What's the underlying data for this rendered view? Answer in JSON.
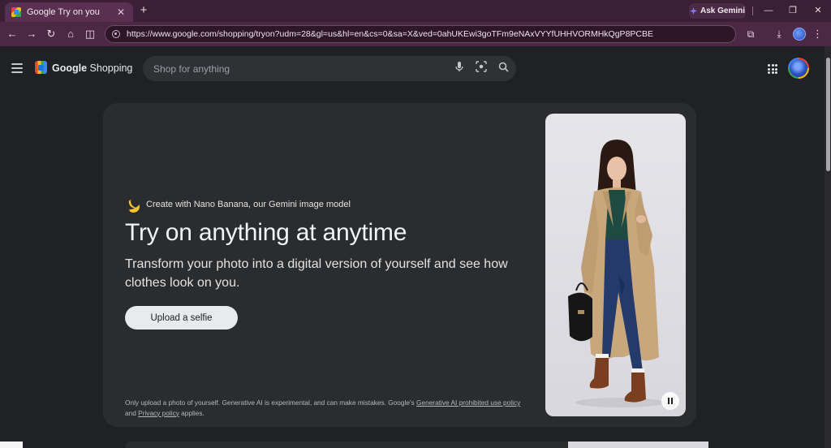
{
  "browser": {
    "tab_title": "Google Try on you",
    "tab_close": "✕",
    "new_tab": "+",
    "ask_gemini": "Ask Gemini",
    "url": "https://www.google.com/shopping/tryon?udm=28&gl=us&hl=en&cs=0&sa=X&ved=0ahUKEwi3goTFm9eNAxVYYfUHHVORMHkQgP8PCBE",
    "window_controls": [
      "—",
      "❐",
      "✕"
    ]
  },
  "header": {
    "brand_google": "Google",
    "brand_shopping": "Shopping",
    "search_placeholder": "Shop for anything"
  },
  "hero": {
    "nano_line": "Create with Nano Banana, our Gemini image model",
    "title": "Try on anything at anytime",
    "subtitle": "Transform your photo into a digital version of yourself and see how clothes look on you.",
    "upload_label": "Upload a selfie",
    "disclaimer_prefix": "Only upload a photo of yourself. Generative AI is experimental, and can make mistakes. Google's ",
    "disclaimer_link1": "Generative AI prohibited use policy",
    "disclaimer_mid": " and ",
    "disclaimer_link2": "Privacy policy",
    "disclaimer_suffix": " applies."
  },
  "colors": {
    "page_bg": "#202124",
    "card_bg": "#2b2c2e",
    "chrome_bg": "#4b2844",
    "coat": "#c9a77c",
    "jeans": "#233a6b",
    "boots": "#7a3e20",
    "top": "#1f4a42"
  }
}
